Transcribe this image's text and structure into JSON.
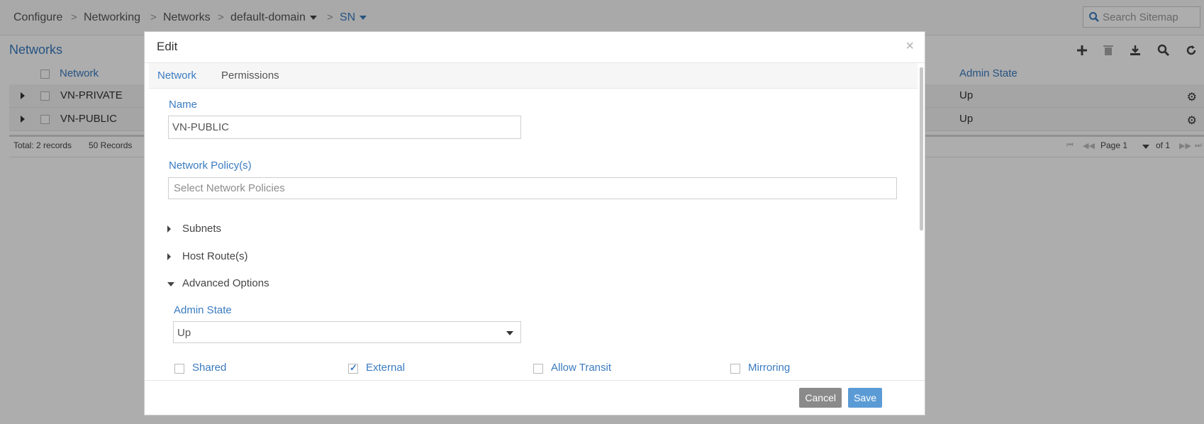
{
  "breadcrumb": {
    "items": [
      "Configure",
      "Networking",
      "Networks",
      "default-domain",
      "SN"
    ],
    "separator": ">"
  },
  "search": {
    "placeholder": "Search Sitemap"
  },
  "page": {
    "section_title": "Networks",
    "toolbar_icons": [
      "plus-icon",
      "trash-icon",
      "download-icon",
      "search-icon",
      "refresh-icon"
    ]
  },
  "table": {
    "columns": [
      "Network",
      "Admin State"
    ],
    "rows": [
      {
        "network": "VN-PRIVATE",
        "admin_state": "Up"
      },
      {
        "network": "VN-PUBLIC",
        "admin_state": "Up"
      }
    ],
    "footer": {
      "total": "Total: 2 records",
      "page_size": "50 Records",
      "page": "Page 1",
      "of": "of 1"
    }
  },
  "modal": {
    "title": "Edit",
    "close": "×",
    "tabs": [
      "Network",
      "Permissions"
    ],
    "active_tab": "Network",
    "name_label": "Name",
    "name_value": "VN-PUBLIC",
    "policy_label": "Network Policy(s)",
    "policy_placeholder": "Select Network Policies",
    "sections": [
      "Subnets",
      "Host Route(s)",
      "Advanced Options"
    ],
    "admin_state_label": "Admin State",
    "admin_state_value": "Up",
    "checkboxes": [
      {
        "label": "Shared",
        "checked": false
      },
      {
        "label": "External",
        "checked": true
      },
      {
        "label": "Allow Transit",
        "checked": false
      },
      {
        "label": "Mirroring",
        "checked": false
      }
    ],
    "cancel_label": "Cancel",
    "save_label": "Save"
  },
  "colors": {
    "accent": "#3a7bc0",
    "save_button": "#5b9bd5",
    "cancel_button": "#8a8a8a"
  }
}
